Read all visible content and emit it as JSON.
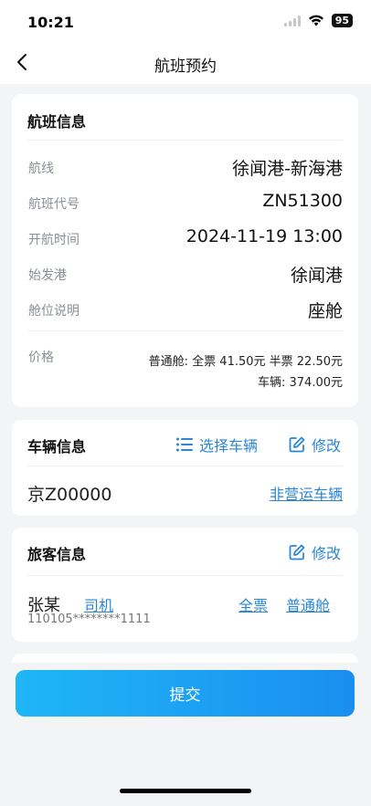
{
  "status_bar": {
    "time": "10:21",
    "battery": "95"
  },
  "nav": {
    "title": "航班预约"
  },
  "flight_info": {
    "title": "航班信息",
    "rows": [
      {
        "label": "航线",
        "value": "徐闻港-新海港"
      },
      {
        "label": "航班代号",
        "value": "ZN51300"
      },
      {
        "label": "开航时间",
        "value": "2024-11-19 13:00"
      },
      {
        "label": "始发港",
        "value": "徐闻港"
      },
      {
        "label": "舱位说明",
        "value": "座舱"
      }
    ],
    "price": {
      "label": "价格",
      "line1": "普通舱: 全票 41.50元 半票 22.50元",
      "line2": "车辆: 374.00元"
    }
  },
  "vehicle_info": {
    "title": "车辆信息",
    "select_label": "选择车辆",
    "edit_label": "修改",
    "plate": "京Z00000",
    "type_link": "非营运车辆"
  },
  "passenger_info": {
    "title": "旅客信息",
    "edit_label": "修改",
    "name": "张某",
    "role": "司机",
    "id_number": "110105********1111",
    "ticket_type": "全票",
    "cabin": "普通舱"
  },
  "submit": {
    "label": "提交"
  },
  "colors": {
    "accent": "#2b86d6",
    "button_start": "#1fb6f6",
    "button_end": "#1a8ef0",
    "background": "#f3f4f6"
  }
}
